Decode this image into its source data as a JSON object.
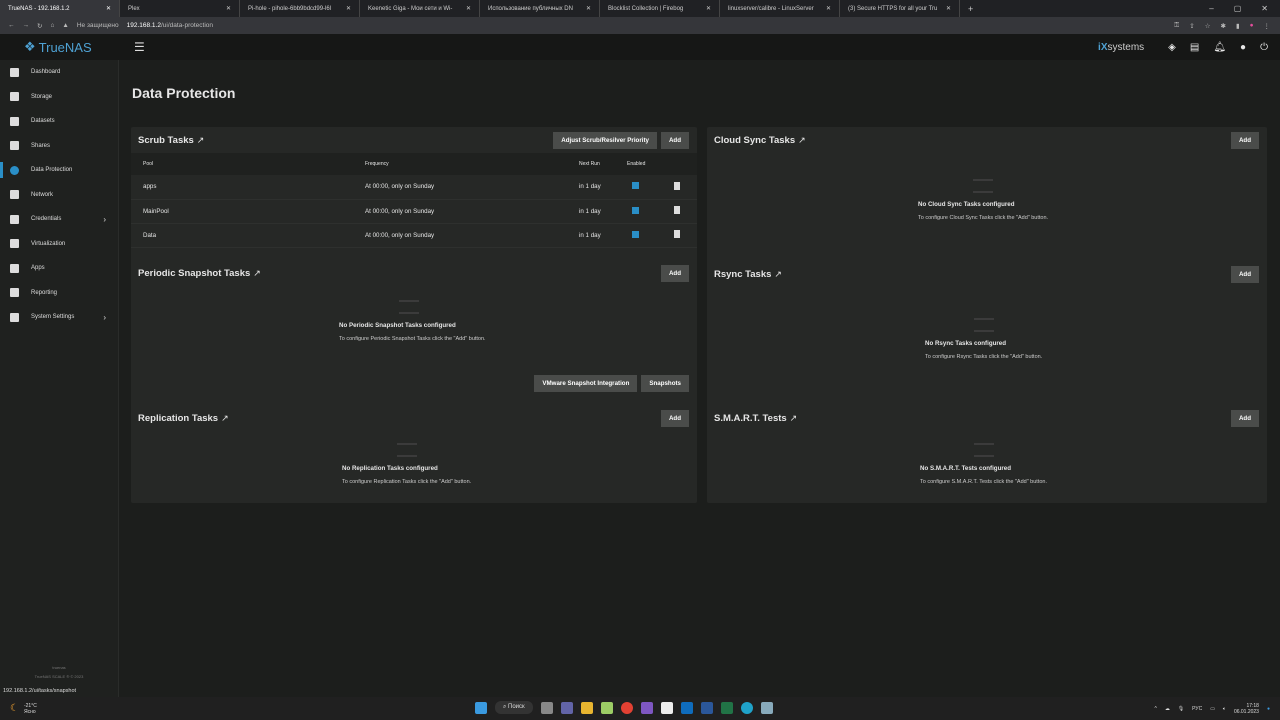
{
  "browser": {
    "tabs": [
      {
        "title": "TrueNAS - 192.168.1.2"
      },
      {
        "title": "Plex"
      },
      {
        "title": "Pi-hole - pihole-6bb9bdcd99-l6l"
      },
      {
        "title": "Keenetic Giga - Мои сети и Wi-"
      },
      {
        "title": "Использование публичных DN"
      },
      {
        "title": "Blocklist Collection | Firebog"
      },
      {
        "title": "linuxserver/calibre - LinuxServer"
      },
      {
        "title": "(3) Secure HTTPS for all your Tru"
      }
    ],
    "security": "Не защищено",
    "url_host": "192.168.1.2",
    "url_path": "/ui/data-protection",
    "status_url": "192.168.1.2/ui/tasks/snapshot"
  },
  "topbar": {
    "logo": "TrueNAS",
    "vendor_prefix": "iX",
    "vendor": "systems"
  },
  "sidebar": {
    "items": [
      {
        "label": "Dashboard"
      },
      {
        "label": "Storage"
      },
      {
        "label": "Datasets"
      },
      {
        "label": "Shares"
      },
      {
        "label": "Data Protection"
      },
      {
        "label": "Network"
      },
      {
        "label": "Credentials"
      },
      {
        "label": "Virtualization"
      },
      {
        "label": "Apps"
      },
      {
        "label": "Reporting"
      },
      {
        "label": "System Settings"
      }
    ],
    "hostname": "truenas",
    "copyright": "TrueNAS SCALE ® © 2023"
  },
  "page": {
    "title": "Data Protection"
  },
  "scrub": {
    "title": "Scrub Tasks",
    "adjust": "Adjust Scrub/Resilver Priority",
    "add": "Add",
    "columns": [
      "Pool",
      "Frequency",
      "Next Run",
      "Enabled"
    ],
    "rows": [
      {
        "pool": "apps",
        "freq": "At 00:00, only on Sunday",
        "next": "in 1 day"
      },
      {
        "pool": "MainPool",
        "freq": "At 00:00, only on Sunday",
        "next": "in 1 day"
      },
      {
        "pool": "Data",
        "freq": "At 00:00, only on Sunday",
        "next": "in 1 day"
      }
    ]
  },
  "cloud": {
    "title": "Cloud Sync Tasks",
    "add": "Add",
    "empty": "No Cloud Sync Tasks configured",
    "hint": "To configure Cloud Sync Tasks click the \"Add\" button."
  },
  "snap": {
    "title": "Periodic Snapshot Tasks",
    "add": "Add",
    "empty": "No Periodic Snapshot Tasks configured",
    "hint": "To configure Periodic Snapshot Tasks click the \"Add\" button.",
    "vmware": "VMware Snapshot Integration",
    "snapshots": "Snapshots"
  },
  "rsync": {
    "title": "Rsync Tasks",
    "add": "Add",
    "empty": "No Rsync Tasks configured",
    "hint": "To configure Rsync Tasks click the \"Add\" button."
  },
  "repl": {
    "title": "Replication Tasks",
    "add": "Add",
    "empty": "No Replication Tasks configured",
    "hint": "To configure Replication Tasks click the \"Add\" button."
  },
  "smart": {
    "title": "S.M.A.R.T. Tests",
    "add": "Add",
    "empty": "No S.M.A.R.T. Tests configured",
    "hint": "To configure S.M.A.R.T. Tests click the \"Add\" button."
  },
  "taskbar": {
    "temp": "-21°C",
    "weather": "Ясно",
    "search": "Поиск",
    "lang": "РУС",
    "time": "17:18",
    "date": "06.01.2023"
  }
}
